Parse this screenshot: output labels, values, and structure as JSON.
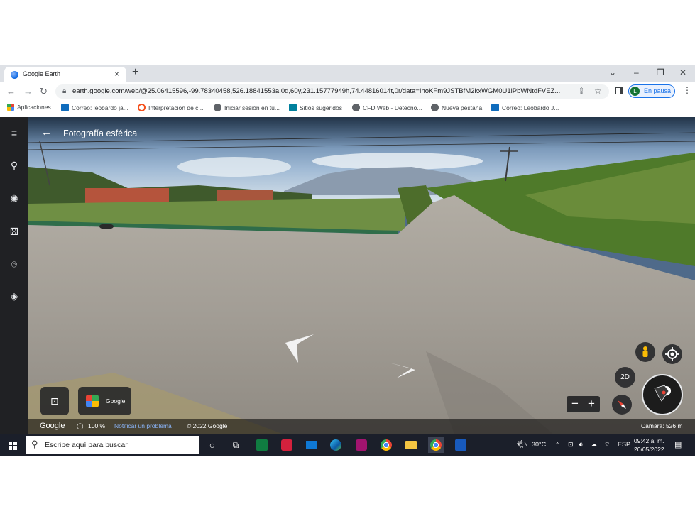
{
  "browser": {
    "tab": {
      "title": "Google Earth"
    },
    "url": "earth.google.com/web/@25.06415596,-99.78340458,526.18841553a,0d,60y,231.15777949h,74.44816014t,0r/data=IhoKFm9JSTBfM2kxWGM0U1lPbWNtdFVEZ...",
    "profile": {
      "initial": "L",
      "label": "En pausa"
    },
    "bookmarks": [
      {
        "label": "Aplicaciones",
        "icon": "apps-grid-icon"
      },
      {
        "label": "Correo: leobardo ja...",
        "icon": "outlook-icon"
      },
      {
        "label": "Interpretación de c...",
        "icon": "ring-icon"
      },
      {
        "label": "Iniciar sesión en tu...",
        "icon": "globe-icon"
      },
      {
        "label": "Sitios sugeridos",
        "icon": "bing-icon"
      },
      {
        "label": "CFD Web - Detecno...",
        "icon": "globe-icon"
      },
      {
        "label": "Nueva pestaña",
        "icon": "globe-icon"
      },
      {
        "label": "Correo: Leobardo J...",
        "icon": "outlook-icon"
      }
    ]
  },
  "earth": {
    "title": "Fotografía esférica",
    "pegman_color": "#fbbc05",
    "two_d_label": "2D",
    "gmaps_label": "Google",
    "status": {
      "logo": "Google",
      "zoom": "100 %",
      "report": "Notificar un problema",
      "copyright": "© 2022 Google",
      "camera": "Cámara: 526 m"
    }
  },
  "taskbar": {
    "search_placeholder": "Escribe aquí para buscar",
    "weather": "30°C",
    "language": "ESP",
    "time": "09:42 a. m.",
    "date": "20/05/2022"
  }
}
